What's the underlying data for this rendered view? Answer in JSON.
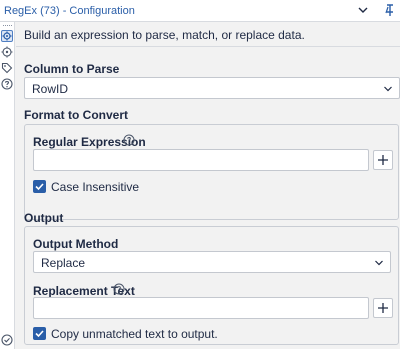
{
  "window": {
    "title": "RegEx (73) - Configuration",
    "collapse_icon": "chevron-down-icon",
    "pin_icon": "pin-icon"
  },
  "rail": {
    "icons": [
      "gear-icon",
      "target-icon",
      "tag-icon",
      "help-icon",
      "status-check-icon"
    ]
  },
  "description": "Build an expression to parse, match, or replace data.",
  "column_to_parse": {
    "label": "Column to Parse",
    "value": "RowID"
  },
  "format_to_convert": {
    "section_label": "Format to Convert",
    "regex_label": "Regular Expression",
    "regex_value": "",
    "case_insensitive_label": "Case Insensitive",
    "case_insensitive_checked": true
  },
  "output": {
    "section_label": "Output",
    "method_label": "Output Method",
    "method_value": "Replace",
    "replacement_label": "Replacement Text",
    "replacement_value": "",
    "copy_unmatched_label": "Copy unmatched text to output.",
    "copy_unmatched_checked": true
  },
  "colors": {
    "accent": "#2a5ea8",
    "border": "#c4c8cf",
    "background": "#f2f2f2"
  }
}
